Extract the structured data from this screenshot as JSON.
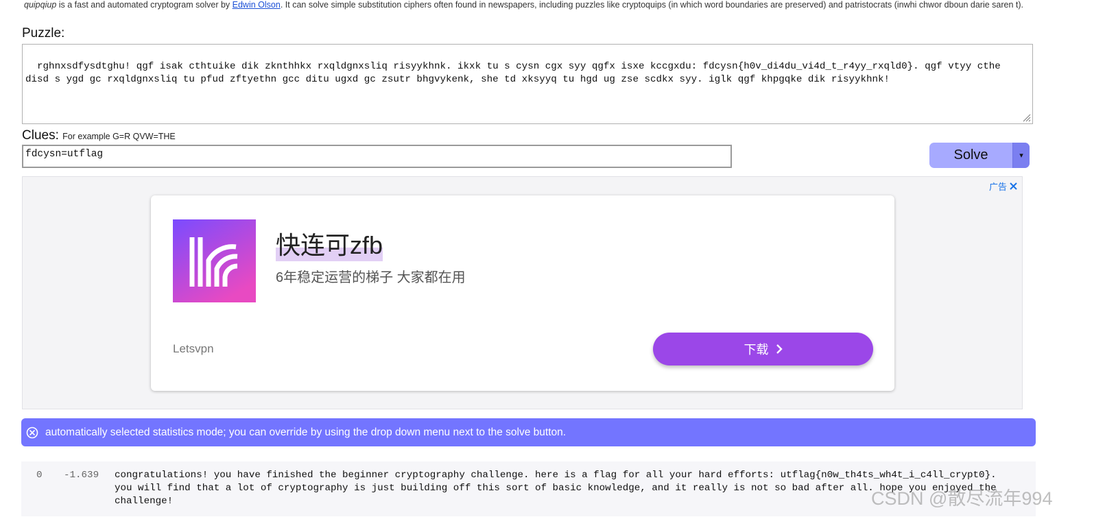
{
  "intro": {
    "app_name": "quipqiup",
    "text_before_link": " is a fast and automated cryptogram solver by ",
    "author_link": "Edwin Olson",
    "text_after_link": ". It can solve simple substitution ciphers often found in newspapers, including puzzles like cryptoquips (in which word boundaries are preserved) and patristocrats (inwhi chwor dboun darie saren t)."
  },
  "puzzle": {
    "label": "Puzzle:",
    "value": "rghnxsdfysdtghu! qgf isak cthtuike dik zknthhkx rxqldgnxsliq risyykhnk. ikxk tu s cysn cgx syy qgfx isxe kccgxdu: fdcysn{h0v_di4du_vi4d_t_r4yy_rxqld0}. qgf vtyy cthe\ndisd s ygd gc rxqldgnxsliq tu pfud zftyethn gcc ditu ugxd gc zsutr bhgvykenk, she td xksyyq tu hgd ug zse scdkx syy. iglk qgf khpgqke dik risyykhnk!"
  },
  "clues": {
    "label": "Clues:",
    "hint": "For example G=R QVW=THE",
    "value": "fdcysn=utflag"
  },
  "solve": {
    "label": "Solve",
    "dropdown": "▾"
  },
  "ad": {
    "choice_label": "广告",
    "title": "快连可zfb",
    "subtitle": "6年稳定运营的梯子 大家都在用",
    "brand": "Letsvpn",
    "cta_label": "下载",
    "colors": {
      "cta": "#9b47e8",
      "icon_top": "#7a4bff",
      "icon_bottom": "#e84ac2"
    }
  },
  "notice": {
    "text": "automatically selected statistics mode; you can override by using the drop down menu next to the solve button.",
    "color": "#7375ff"
  },
  "results": [
    {
      "index": "0",
      "score": "-1.639",
      "text": "congratulations! you have finished the beginner cryptography challenge. here is a flag for all your hard efforts: utflag{n0w_th4ts_wh4t_i_c4ll_crypt0}.\nyou will find that a lot of cryptography is just building off this sort of basic knowledge, and it really is not so bad after all. hope you enjoyed the\nchallenge!"
    }
  ],
  "watermark": "CSDN @散尽流年994"
}
